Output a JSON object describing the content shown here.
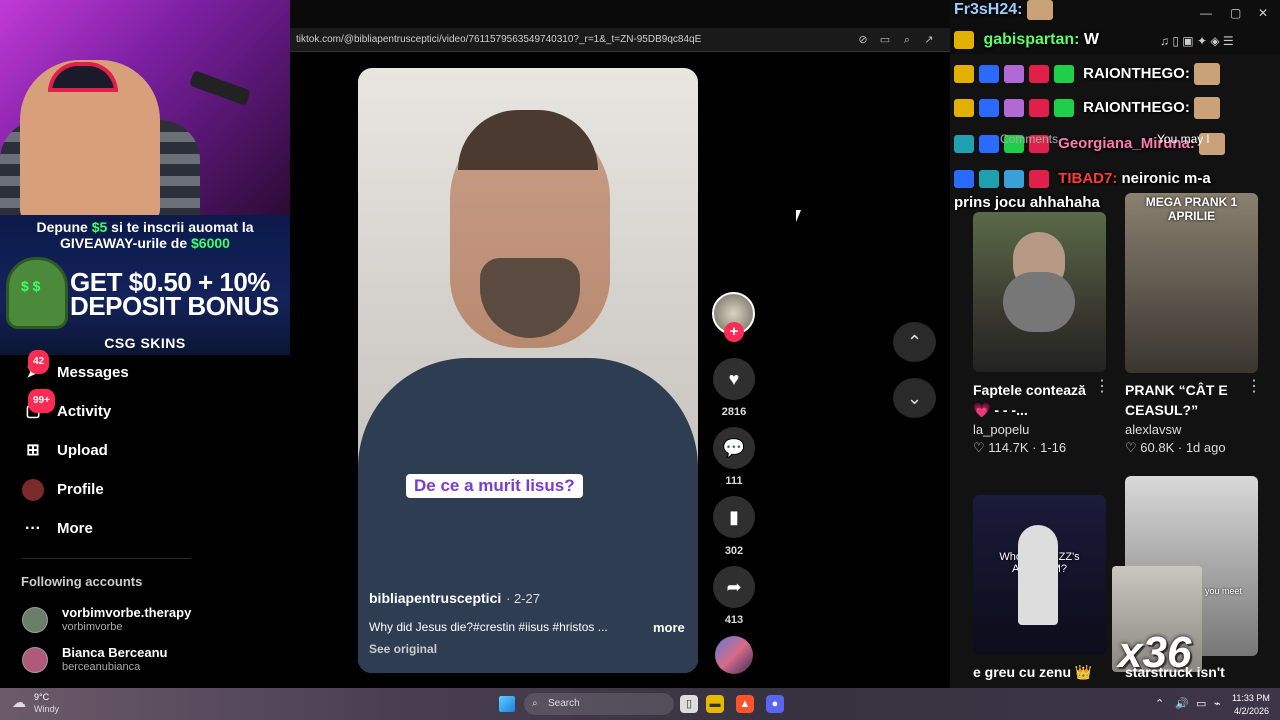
{
  "browser": {
    "url": "tiktok.com/@bibliapentrusceptici/video/7611579563549740310?_r=1&_t=ZN-95DB9qc84qE"
  },
  "stream_promo": {
    "line1_prefix": "Depune",
    "line1_amount": "$5",
    "line1_suffix": "si te inscrii auomat la",
    "line2_prefix": "GIVEAWAY-urile de",
    "line2_amount": "$6000",
    "big_line1": "GET $0.50 + 10%",
    "big_line2": "DEPOSIT BONUS",
    "brand": "CSG SKINS"
  },
  "nav": {
    "items": [
      {
        "label": "Messages",
        "badge": "42",
        "icon": "paper-plane-icon"
      },
      {
        "label": "Activity",
        "badge": "99+",
        "icon": "inbox-icon"
      },
      {
        "label": "Upload",
        "badge": "",
        "icon": "plus-square-icon"
      },
      {
        "label": "Profile",
        "badge": "",
        "icon": "avatar-icon"
      },
      {
        "label": "More",
        "badge": "",
        "icon": "ellipsis-icon"
      }
    ],
    "following_title": "Following accounts",
    "following": [
      {
        "name": "vorbimvorbe.therapy",
        "handle": "vorbimvorbe"
      },
      {
        "name": "Bianca Berceanu",
        "handle": "berceanubianca"
      }
    ]
  },
  "video": {
    "caption_overlay": "De ce a murit Iisus?",
    "username": "bibliapentrusceptici",
    "date": "· 2-27",
    "description": "Why did Jesus die?#crestin #iisus #hristos ...",
    "more": "more",
    "see_original": "See original",
    "likes": "2816",
    "comments": "111",
    "saves": "302",
    "shares": "413"
  },
  "chat": {
    "lines": [
      {
        "name": "Fr3sH24:",
        "text": ""
      },
      {
        "name": "gabispartan:",
        "text": "W"
      },
      {
        "name": "RAIONTHEGO:",
        "text": ""
      },
      {
        "name": "RAIONTHEGO:",
        "text": ""
      },
      {
        "name": "Georgiana_Miruna:",
        "text": ""
      },
      {
        "name": "TIBAD7:",
        "text": "neironic m-a"
      },
      {
        "name": "",
        "text": "prins jocu ahhahaha"
      }
    ],
    "overlay_comments": "Comments",
    "overlay_you_may": "You may l"
  },
  "recommendations": [
    {
      "title": "Faptele contează 💗 - - -...",
      "user": "la_popelu",
      "likes": "114.7K",
      "when": "1-16",
      "overlay": ""
    },
    {
      "title": "PRANK “CÂT E CEASUL?”",
      "user": "alexlavsw",
      "likes": "60.8K",
      "when": "1d ago",
      "overlay": "MEGA PRANK 1 APRILIE"
    },
    {
      "title": "e greu cu zenu 👑",
      "user": "",
      "likes": "",
      "when": "",
      "overlay": "Who $tebo2ZZ's AdelinMM?"
    },
    {
      "title": "starstruck isn't",
      "user": "",
      "likes": "",
      "when": "",
      "overlay": "you meet"
    }
  ],
  "gift_overlay": "x36",
  "taskbar": {
    "temp": "9°C",
    "condition": "Windy",
    "search": "Search",
    "time": "11:33 PM",
    "date": "4/2/2026"
  },
  "colors": {
    "accent": "#fe2c55",
    "caption_text": "#7a3bd1",
    "promo_green": "#3dff6a"
  }
}
